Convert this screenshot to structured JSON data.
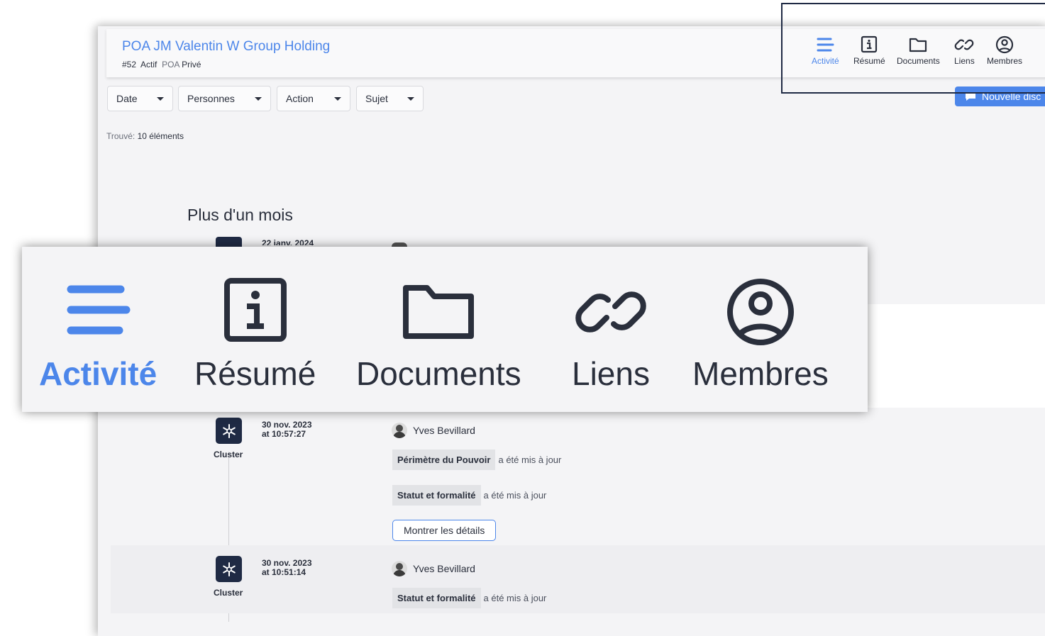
{
  "header": {
    "title": "POA JM Valentin W Group Holding",
    "id": "#52",
    "status": "Actif",
    "type": "POA",
    "visibility": "Privé"
  },
  "nav": [
    {
      "label": "Activité",
      "icon": "menu-lines-icon",
      "active": true
    },
    {
      "label": "Résumé",
      "icon": "info-box-icon",
      "active": false
    },
    {
      "label": "Documents",
      "icon": "folder-icon",
      "active": false
    },
    {
      "label": "Liens",
      "icon": "link-icon",
      "active": false
    },
    {
      "label": "Membres",
      "icon": "user-circle-icon",
      "active": false
    }
  ],
  "new_discussion_label": "Nouvelle disc",
  "filters": {
    "date": "Date",
    "personnes": "Personnes",
    "action": "Action",
    "sujet": "Sujet"
  },
  "found": {
    "prefix": "Trouvé:",
    "count_text": "10 éléments"
  },
  "section_title": "Plus d'un mois",
  "partial_date": "22 janv. 2024",
  "entries": [
    {
      "date": "30 nov. 2023",
      "time": "at 10:57:27",
      "source": "Cluster",
      "author": "Yves Bevillard",
      "changes": [
        {
          "field": "Périmètre du Pouvoir",
          "text": "a été mis à jour"
        },
        {
          "field": "Statut et formalité",
          "text": "a été mis à jour"
        }
      ],
      "details_label": "Montrer les détails"
    },
    {
      "date": "30 nov. 2023",
      "time": "at 10:51:14",
      "source": "Cluster",
      "author": "Yves Bevillard",
      "changes": [
        {
          "field": "Statut et formalité",
          "text": "a été mis à jour"
        }
      ]
    }
  ],
  "colors": {
    "accent": "#4c86ea",
    "dark": "#1f2a44",
    "text": "#2a2f3c"
  }
}
